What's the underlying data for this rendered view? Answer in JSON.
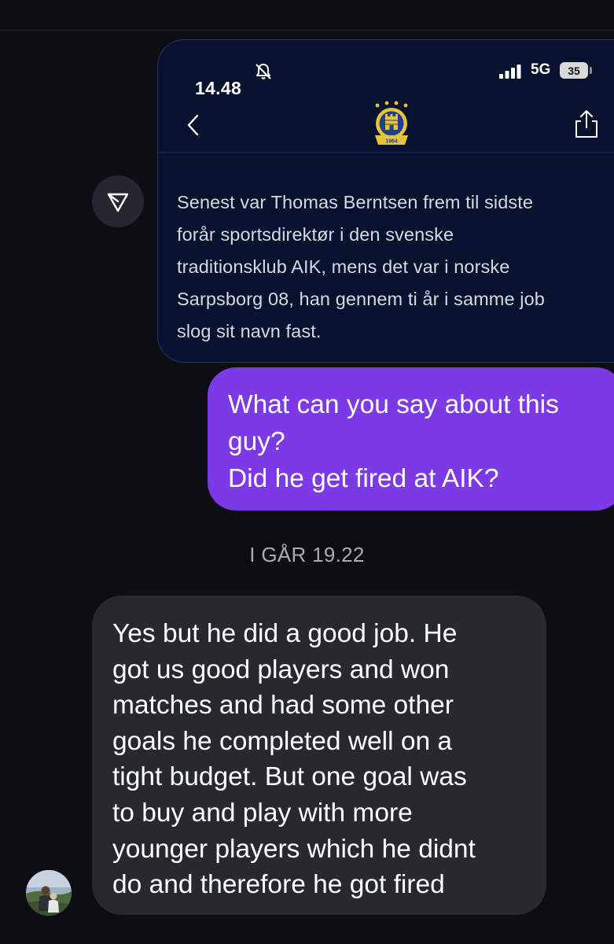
{
  "shared_screenshot": {
    "status_time": "14.48",
    "network": "5G",
    "battery_level": "35",
    "crest_year": "1964",
    "article_text": "Senest var Thomas Berntsen frem til sidste\nforår sportsdirektør i den svenske\ntraditionsklub AIK, mens det var i norske\nSarpsborg 08, han gennem ti år i samme job\nslog sit navn fast."
  },
  "messages": [
    {
      "direction": "outgoing",
      "text": "What can you say about this\nguy?\nDid he get fired at AIK?"
    },
    {
      "direction": "incoming",
      "text": "Yes but he did a good job. He\ngot us good players and won\nmatches and had some other\ngoals he completed well on a\ntight budget. But one goal was\nto buy and play with more\nyounger players which he didnt\ndo and therefore he got fired"
    }
  ],
  "timestamp": "I GÅR 19.22",
  "colors": {
    "background": "#0c0e13",
    "outgoing_bubble": "#7b3ae6",
    "incoming_bubble": "#26292e",
    "shared_card": "#07122e",
    "crest_gold": "#e8c23a",
    "crest_blue": "#1d3f8f"
  },
  "icons": {
    "status_bell": "bell-slash-icon",
    "status_signal": "cellular-signal-icon",
    "nav_back": "chevron-left-icon",
    "nav_share": "share-icon",
    "forward": "send-forward-icon",
    "crest": "club-crest-icon"
  }
}
